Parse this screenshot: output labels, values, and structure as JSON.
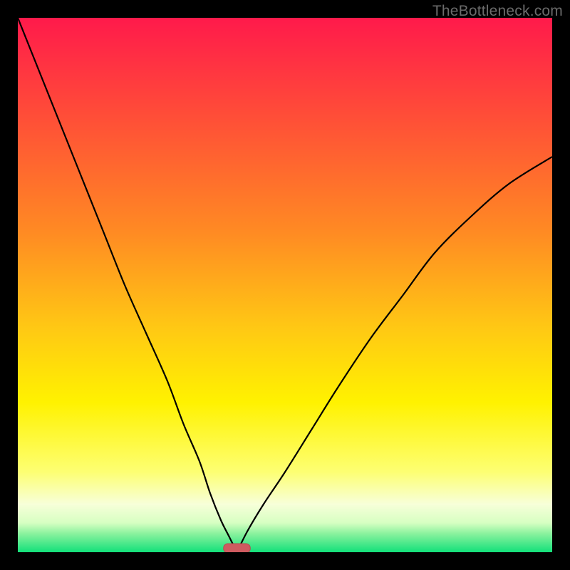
{
  "watermark": "TheBottleneck.com",
  "colors": {
    "frame": "#000000",
    "curve": "#000000",
    "marker_fill": "#cf5b60",
    "marker_stroke": "#b94a50",
    "gradient_stops": [
      {
        "offset": 0.0,
        "color": "#ff1a4b"
      },
      {
        "offset": 0.2,
        "color": "#ff5236"
      },
      {
        "offset": 0.4,
        "color": "#ff8a23"
      },
      {
        "offset": 0.58,
        "color": "#ffc814"
      },
      {
        "offset": 0.72,
        "color": "#fff200"
      },
      {
        "offset": 0.85,
        "color": "#fdff73"
      },
      {
        "offset": 0.91,
        "color": "#f7ffd9"
      },
      {
        "offset": 0.945,
        "color": "#d7ffc2"
      },
      {
        "offset": 0.965,
        "color": "#8bf29e"
      },
      {
        "offset": 1.0,
        "color": "#13e07a"
      }
    ]
  },
  "chart_data": {
    "type": "line",
    "title": "",
    "xlabel": "",
    "ylabel": "",
    "xrange": [
      0,
      100
    ],
    "yrange": [
      0,
      100
    ],
    "note": "Two monotone branches meeting at a cusp near the bottom; values are normalized percentages read off the plot.",
    "cusp": {
      "x": 41,
      "y": 0
    },
    "marker": {
      "x_center": 41,
      "y": 0,
      "width": 5
    },
    "series": [
      {
        "name": "left-branch",
        "x": [
          0,
          4,
          8,
          12,
          16,
          20,
          24,
          28,
          31,
          34,
          36,
          38,
          39.5,
          41
        ],
        "y": [
          100,
          90,
          80,
          70,
          60,
          50,
          41,
          32,
          24,
          17,
          11,
          6,
          3,
          0
        ]
      },
      {
        "name": "right-branch",
        "x": [
          41,
          43,
          46,
          50,
          55,
          60,
          66,
          72,
          78,
          85,
          92,
          100
        ],
        "y": [
          0,
          4,
          9,
          15,
          23,
          31,
          40,
          48,
          56,
          63,
          69,
          74
        ]
      }
    ]
  }
}
